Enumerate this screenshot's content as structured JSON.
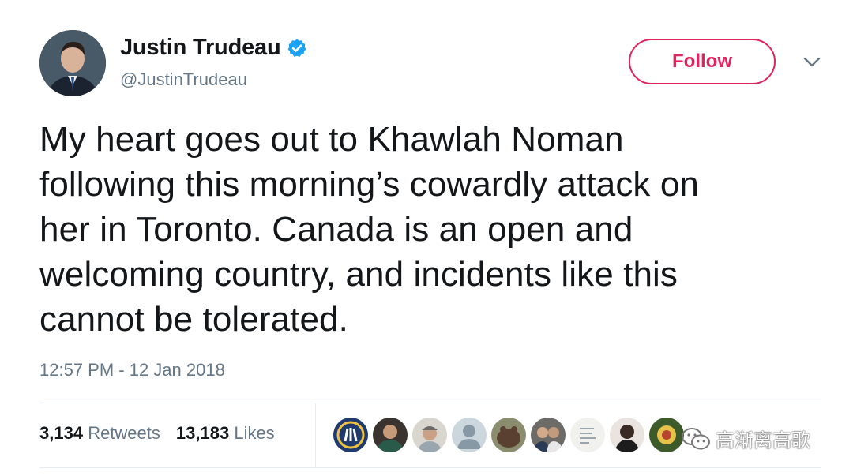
{
  "user": {
    "name": "Justin Trudeau",
    "handle": "@JustinTrudeau",
    "verified_icon": "verified-badge-icon",
    "avatar_icon": "profile-photo"
  },
  "follow_button": {
    "label": "Follow",
    "color": "#e0245e"
  },
  "menu": {
    "icon": "chevron-down-icon"
  },
  "tweet": {
    "lines": [
      "My heart goes out to Khawlah Noman",
      "following this morning’s cowardly attack on",
      "her in Toronto. Canada is an open and",
      "welcoming country, and incidents like this",
      "cannot be tolerated."
    ],
    "timestamp": "12:57 PM - 12 Jan 2018"
  },
  "stats": {
    "retweets_count": "3,134",
    "retweets_label": "Retweets",
    "likes_count": "13,183",
    "likes_label": "Likes"
  },
  "likers": [
    "liker-1",
    "liker-2",
    "liker-3",
    "liker-4",
    "liker-5",
    "liker-6",
    "liker-7",
    "liker-8",
    "liker-9"
  ],
  "watermark": {
    "text": "高渐离高歌",
    "icon": "wechat-icon"
  },
  "colors": {
    "accent": "#e0245e",
    "verified": "#1da1f2",
    "secondary_text": "#657786"
  }
}
